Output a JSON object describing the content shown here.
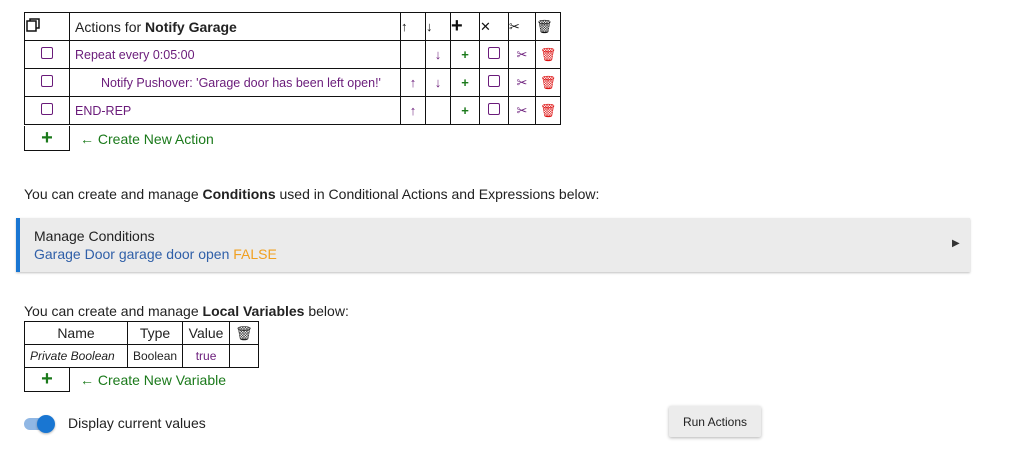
{
  "actions_table": {
    "header": {
      "title_prefix": "Actions for ",
      "title_rule": "Notify Garage"
    },
    "rows": [
      {
        "text": "Repeat every 0:05:00"
      },
      {
        "text": "Notify Pushover: 'Garage door has been left open!'"
      },
      {
        "text": "END-REP"
      }
    ],
    "create_label": "Create New Action"
  },
  "conditions_intro": {
    "before": "You can create and manage ",
    "bold": "Conditions",
    "after": " used in Conditional Actions and Expressions below:"
  },
  "manage_conditions": {
    "title": "Manage Conditions",
    "summary_text": "Garage Door garage door open ",
    "summary_state": "FALSE"
  },
  "variables_intro": {
    "before": "You can create and manage ",
    "bold": "Local Variables",
    "after": " below:"
  },
  "variables_table": {
    "headers": [
      "Name",
      "Type",
      "Value"
    ],
    "rows": [
      {
        "name": "Private Boolean",
        "type": "Boolean",
        "value": "true"
      }
    ],
    "create_label": "Create New Variable"
  },
  "display_toggle": {
    "label": "Display current values",
    "on": true
  },
  "run_button": {
    "label": "Run Actions"
  },
  "colors": {
    "accent": "#1976d2",
    "green": "#1b7a1b",
    "purple": "#6a1b7a",
    "delete_red": "#d11111",
    "false_orange": "#f0a020"
  },
  "icons": [
    "copy-icon",
    "arrow-up-icon",
    "arrow-down-icon",
    "plus-icon",
    "close-icon",
    "scissors-icon",
    "trash-icon",
    "checkbox-icon",
    "left-arrow-icon",
    "triangle-right-icon"
  ]
}
